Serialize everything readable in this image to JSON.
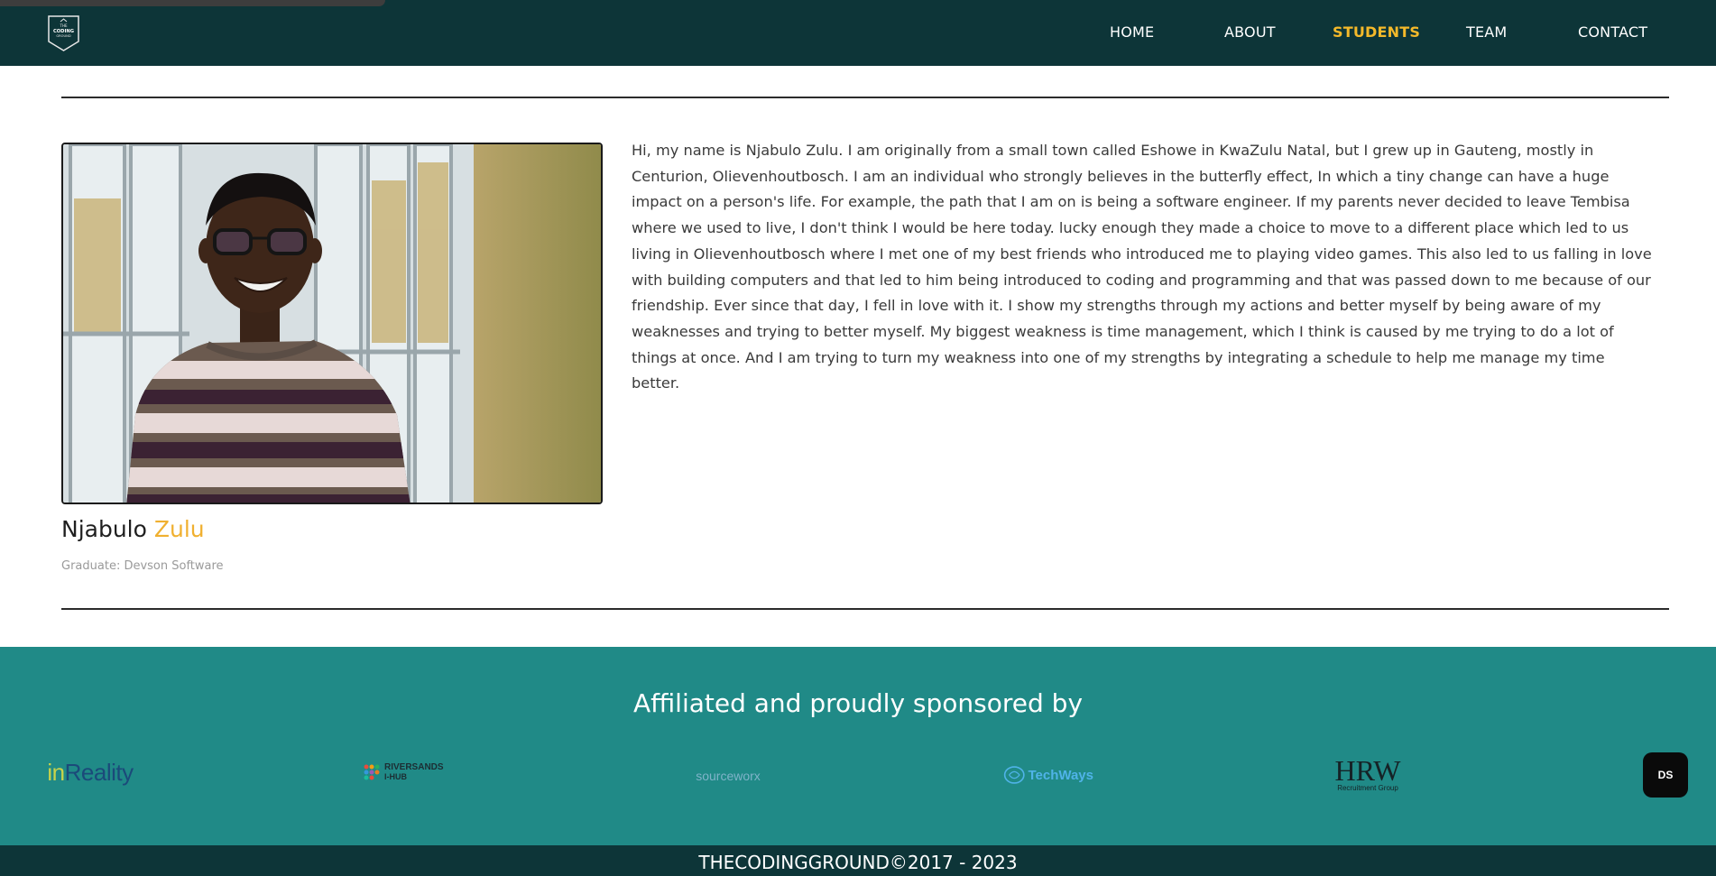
{
  "nav": {
    "logo_text": "THE CODING GROUND",
    "links": [
      "HOME",
      "ABOUT",
      "STUDENTS",
      "TEAM",
      "CONTACT"
    ]
  },
  "profile": {
    "first_name": "Njabulo",
    "last_name": "Zulu",
    "role": "Graduate: Devson Software",
    "bio": "Hi, my name is Njabulo Zulu. I am originally from a small town called Eshowe in KwaZulu Natal, but I grew up in Gauteng, mostly in Centurion, Olievenhoutbosch. I am an individual who strongly believes in the butterfly effect, In which a tiny change can have a huge impact on a person's life. For example, the path that I am on is being a software engineer. If my parents never decided to leave Tembisa where we used to live, I don't think I would be here today. lucky enough they made a choice to move to a different place which led to us living in Olievenhoutbosch where I met one of my best friends who introduced me to playing video games. This also led to us falling in love with building computers and that led to him being introduced to coding and programming and that was passed down to me because of our friendship. Ever since that day, I fell in love with it. I show my strengths through my actions and better myself by being aware of my weaknesses and trying to better myself. My biggest weakness is time management, which I think is caused by me trying to do a lot of things at once. And I am trying to turn my weakness into one of my strengths by integrating a schedule to help me manage my time better."
  },
  "sponsors": {
    "title": "Affiliated and proudly sponsored by",
    "logos": [
      {
        "name": "inReality",
        "part1": "in",
        "part2": "Reality"
      },
      {
        "name": "Riversands I-Hub",
        "line1": "RIVERSANDS",
        "line2": "I-HUB"
      },
      {
        "name": "sourceworx",
        "text": "sourceworx"
      },
      {
        "name": "TechWays",
        "text": "TechWays"
      },
      {
        "name": "HRW Recruitment Group",
        "main": "HRW",
        "sub": "Recruitment Group"
      },
      {
        "name": "Devson Software",
        "text": "DS"
      }
    ]
  },
  "footer": {
    "text": "THECODINGGROUND©2017 - 2023"
  },
  "colors": {
    "nav_bg": "#0d3538",
    "accent": "#f4b92a",
    "sponsor_bg": "#208a87"
  }
}
